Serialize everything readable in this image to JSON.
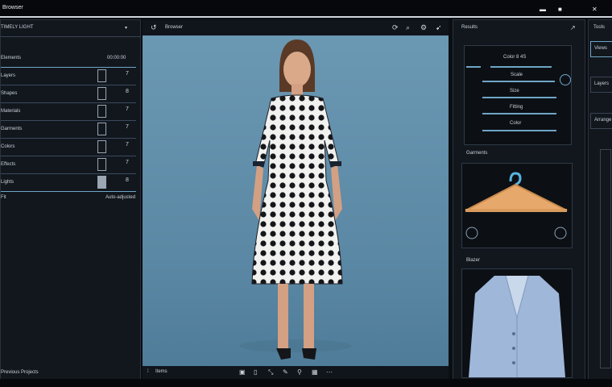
{
  "app": {
    "title": "Browser"
  },
  "window_controls": [
    "minimize-icon",
    "maximize-icon",
    "close-icon"
  ],
  "left_panel": {
    "header": "TIMELY LIGHT",
    "header_icon": "▾",
    "top_row": {
      "label": "Elements",
      "value": "00:00:00"
    },
    "rows": [
      {
        "label": "Layers",
        "count": "7"
      },
      {
        "label": "Shapes",
        "count": "8"
      },
      {
        "label": "Materials",
        "count": "7"
      },
      {
        "label": "Garments",
        "count": "7"
      },
      {
        "label": "Colors",
        "count": "7"
      },
      {
        "label": "Effects",
        "count": "7"
      },
      {
        "label": "Lights",
        "count": "8"
      }
    ],
    "footer_row": {
      "label": "Fit",
      "value": "Auto-adjusted"
    },
    "bottom_label": "Previous Projects"
  },
  "center": {
    "header": "Browser",
    "header_icons": [
      "refresh-icon",
      "search-icon",
      "settings-icon",
      "cursor-icon"
    ],
    "footer_label": "Items"
  },
  "right_panel": {
    "header": "Results",
    "header_icon": "↗",
    "sliders": [
      {
        "label": "Color 8 4S"
      },
      {
        "label": "Scale"
      },
      {
        "label": "Size"
      },
      {
        "label": "Fitting"
      },
      {
        "label": "Color"
      }
    ],
    "section_hanger": "Garments",
    "section_jacket": "Blazer"
  },
  "far_panel": {
    "items": [
      "Tools",
      "Views",
      "Layers",
      "Arrange"
    ]
  },
  "colors": {
    "accent": "#6fa6c7",
    "stage": "#5d8ba7",
    "panel": "#12171e"
  }
}
